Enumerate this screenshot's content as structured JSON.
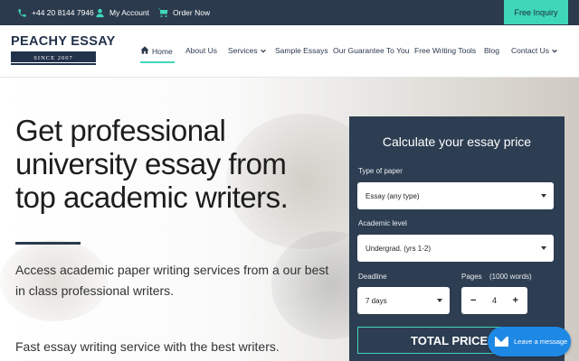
{
  "topbar": {
    "phone": "+44 20 8144 7946",
    "account": "My Account",
    "order": "Order Now",
    "inquiry": "Free Inquiry"
  },
  "logo": {
    "name": "PEACHY ESSAY",
    "since": "SINCE 2007"
  },
  "nav": {
    "items": [
      {
        "label": "Home"
      },
      {
        "label": "About Us"
      },
      {
        "label": "Services"
      },
      {
        "label": "Sample Essays"
      },
      {
        "label": "Our Guarantee To You"
      },
      {
        "label": "Free Writing Tools"
      },
      {
        "label": "Blog"
      },
      {
        "label": "Contact Us"
      }
    ]
  },
  "hero": {
    "headline": "Get professional university essay from top academic writers.",
    "subtext": "Access academic paper writing services from a our best in class professional writers.",
    "subtext2": "Fast essay writing service with the best writers."
  },
  "calculator": {
    "title": "Calculate your essay price",
    "type_label": "Type of paper",
    "type_value": "Essay (any type)",
    "level_label": "Academic level",
    "level_value": "Undergrad. (yrs 1-2)",
    "deadline_label": "Deadline",
    "deadline_value": "7 days",
    "pages_label": "Pages",
    "pages_note": "(1000 words)",
    "pages_value": "4",
    "minus": "−",
    "plus": "+",
    "total": "TOTAL PRICE: $1"
  },
  "chat": {
    "label": "Leave a message"
  },
  "colors": {
    "navy": "#2b3a4d",
    "accent": "#3ed7b8",
    "chat": "#1e88e5"
  }
}
